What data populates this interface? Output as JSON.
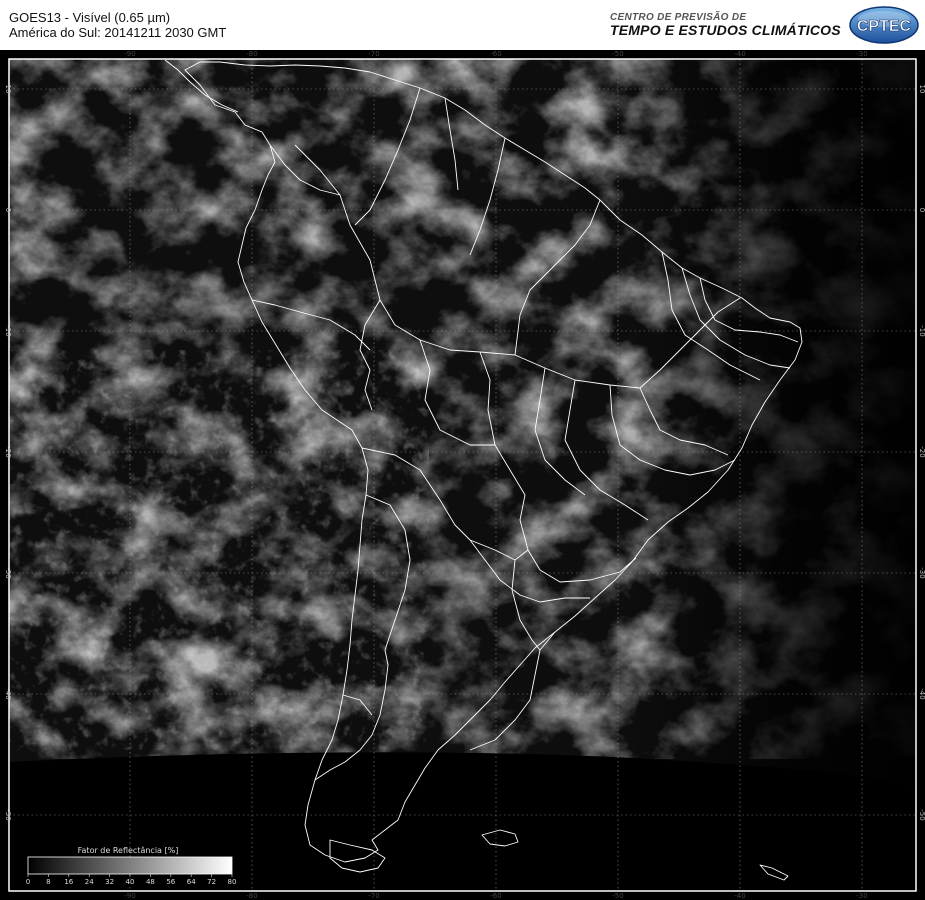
{
  "header": {
    "title_line1": "GOES13 - Visível (0.65 µm)",
    "title_line2": "América do Sul: 20141211 2030 GMT",
    "org_line1": "CENTRO DE PREVISÃO DE",
    "org_line2": "TEMPO E ESTUDOS CLIMÁTICOS",
    "logo_text": "CPTEC"
  },
  "map": {
    "lon_ticks": [
      "-90",
      "-80",
      "-70",
      "-60",
      "-50",
      "-40",
      "-30"
    ],
    "lat_ticks": [
      "10",
      "0",
      "-10",
      "-20",
      "-30",
      "-40",
      "-50"
    ],
    "grid_style": "dotted"
  },
  "legend": {
    "title": "Fator de Reflectância [%]",
    "ticks": [
      "0",
      "8",
      "16",
      "24",
      "32",
      "40",
      "48",
      "56",
      "64",
      "72",
      "80"
    ]
  },
  "colors": {
    "background": "#ffffff",
    "space": "#000000",
    "borders": "#ffffff",
    "grid": "#888888"
  }
}
